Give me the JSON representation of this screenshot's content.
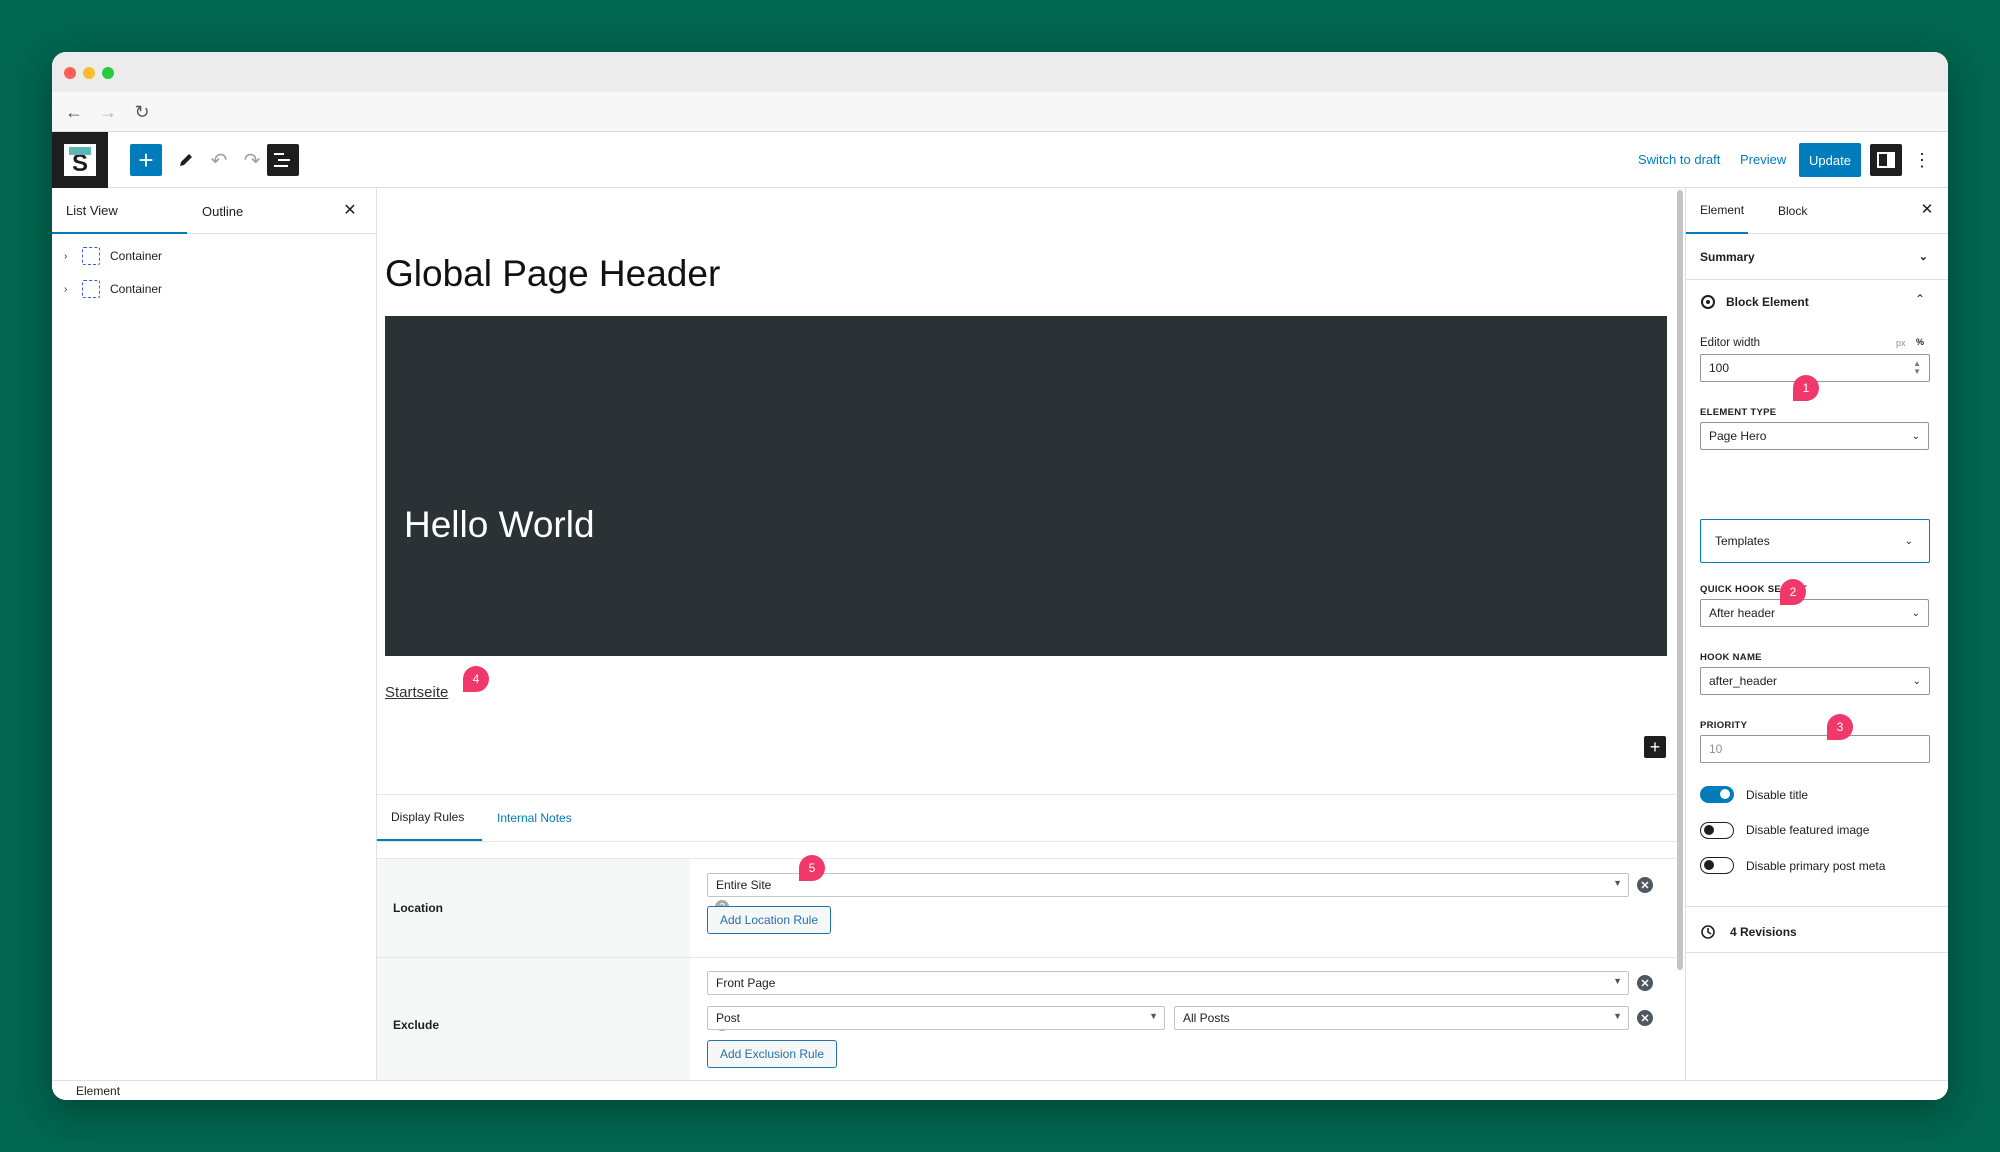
{
  "toolbar": {
    "switch_to_draft": "Switch to draft",
    "preview": "Preview",
    "update": "Update"
  },
  "left_panel": {
    "tab_list_view": "List View",
    "tab_outline": "Outline",
    "items": [
      {
        "label": "Container"
      },
      {
        "label": "Container"
      }
    ]
  },
  "canvas": {
    "page_title": "Global Page Header",
    "hero_text": "Hello World",
    "breadcrumb": "Startseite"
  },
  "meta_box": {
    "tab_display_rules": "Display Rules",
    "tab_internal_notes": "Internal Notes",
    "location": {
      "label": "Location",
      "value": "Entire Site",
      "add_button": "Add Location Rule"
    },
    "exclude": {
      "label": "Exclude",
      "rule1": "Front Page",
      "rule2_type": "Post",
      "rule2_value": "All Posts",
      "add_button": "Add Exclusion Rule"
    }
  },
  "right_panel": {
    "tab_element": "Element",
    "tab_block": "Block",
    "summary": "Summary",
    "block_element": "Block Element",
    "editor_width_label": "Editor width",
    "editor_width_value": "100",
    "unit_px": "px",
    "unit_percent": "%",
    "element_type_label": "ELEMENT TYPE",
    "element_type_value": "Page Hero",
    "templates": "Templates",
    "quick_hook_label": "QUICK HOOK SELECT",
    "quick_hook_value": "After header",
    "hook_name_label": "HOOK NAME",
    "hook_name_value": "after_header",
    "priority_label": "PRIORITY",
    "priority_placeholder": "10",
    "toggles": [
      {
        "label": "Disable title",
        "on": true
      },
      {
        "label": "Disable featured image",
        "on": false
      },
      {
        "label": "Disable primary post meta",
        "on": false
      }
    ],
    "revisions": "4 Revisions"
  },
  "statusbar": {
    "breadcrumb": "Element"
  },
  "badges": [
    "1",
    "2",
    "3",
    "4",
    "5"
  ],
  "colors": {
    "background": "#00674f",
    "accent": "#007cba",
    "hero": "#2b3236",
    "badge": "#f0386b"
  }
}
